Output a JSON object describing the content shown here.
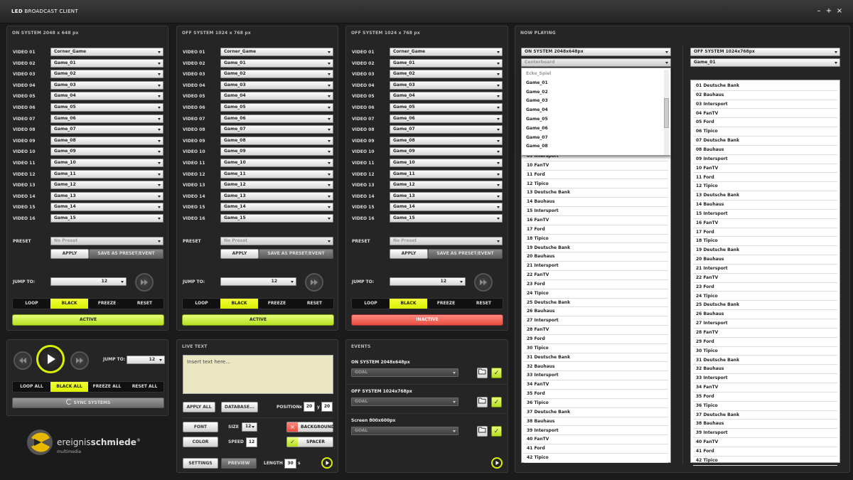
{
  "app": {
    "title_bold": "LED",
    "title_rest": " BROADCAST CLIENT",
    "win_min": "–",
    "win_max": "+",
    "win_close": "×"
  },
  "video_label_prefix": "VIDEO",
  "panels": [
    {
      "title": "ON SYSTEM 2048 x 648 px",
      "videos": [
        {
          "label": "VIDEO 01",
          "value": "Corner_Game"
        },
        {
          "label": "VIDEO 02",
          "value": "Game_01"
        },
        {
          "label": "VIDEO 03",
          "value": "Game_02"
        },
        {
          "label": "VIDEO 04",
          "value": "Game_03"
        },
        {
          "label": "VIDEO 05",
          "value": "Game_04"
        },
        {
          "label": "VIDEO 06",
          "value": "Game_05"
        },
        {
          "label": "VIDEO 07",
          "value": "Game_06"
        },
        {
          "label": "VIDEO 08",
          "value": "Game_07"
        },
        {
          "label": "VIDEO 09",
          "value": "Game_08"
        },
        {
          "label": "VIDEO 10",
          "value": "Game_09"
        },
        {
          "label": "VIDEO 11",
          "value": "Game_10"
        },
        {
          "label": "VIDEO 12",
          "value": "Game_11"
        },
        {
          "label": "VIDEO 13",
          "value": "Game_12"
        },
        {
          "label": "VIDEO 14",
          "value": "Game_13"
        },
        {
          "label": "VIDEO 15",
          "value": "Game_14"
        },
        {
          "label": "VIDEO 16",
          "value": "Game_15"
        }
      ],
      "preset_label": "PRESET",
      "preset_value": "No Preset",
      "apply": "APPLY",
      "save": "SAVE AS PRESET/EVENT",
      "jump_label": "JUMP TO:",
      "jump_value": "12",
      "modes": [
        "LOOP",
        "BLACK",
        "FREEZE",
        "RESET"
      ],
      "mode_active": "BLACK",
      "status": "ACTIVE"
    },
    {
      "title": "OFF SYSTEM 1024 x 768 px",
      "videos": [
        {
          "label": "VIDEO 01",
          "value": "Corner_Game"
        },
        {
          "label": "VIDEO 02",
          "value": "Game_01"
        },
        {
          "label": "VIDEO 03",
          "value": "Game_02"
        },
        {
          "label": "VIDEO 04",
          "value": "Game_03"
        },
        {
          "label": "VIDEO 05",
          "value": "Game_04"
        },
        {
          "label": "VIDEO 06",
          "value": "Game_05"
        },
        {
          "label": "VIDEO 07",
          "value": "Game_06"
        },
        {
          "label": "VIDEO 08",
          "value": "Game_07"
        },
        {
          "label": "VIDEO 09",
          "value": "Game_08"
        },
        {
          "label": "VIDEO 10",
          "value": "Game_09"
        },
        {
          "label": "VIDEO 11",
          "value": "Game_10"
        },
        {
          "label": "VIDEO 12",
          "value": "Game_11"
        },
        {
          "label": "VIDEO 13",
          "value": "Game_12"
        },
        {
          "label": "VIDEO 14",
          "value": "Game_13"
        },
        {
          "label": "VIDEO 15",
          "value": "Game_14"
        },
        {
          "label": "VIDEO 16",
          "value": "Game_15"
        }
      ],
      "preset_label": "PRESET",
      "preset_value": "No Preset",
      "apply": "APPLY",
      "save": "SAVE AS PRESET/EVENT",
      "jump_label": "JUMP TO:",
      "jump_value": "12",
      "modes": [
        "LOOP",
        "BLACK",
        "FREEZE",
        "RESET"
      ],
      "mode_active": "BLACK",
      "status": "ACTIVE"
    },
    {
      "title": "OFF SYSTEM 1024 x 768 px",
      "videos": [
        {
          "label": "VIDEO 01",
          "value": "Corner_Game"
        },
        {
          "label": "VIDEO 02",
          "value": "Game_01"
        },
        {
          "label": "VIDEO 03",
          "value": "Game_02"
        },
        {
          "label": "VIDEO 04",
          "value": "Game_03"
        },
        {
          "label": "VIDEO 05",
          "value": "Game_04"
        },
        {
          "label": "VIDEO 06",
          "value": "Game_05"
        },
        {
          "label": "VIDEO 07",
          "value": "Game_06"
        },
        {
          "label": "VIDEO 08",
          "value": "Game_07"
        },
        {
          "label": "VIDEO 09",
          "value": "Game_08"
        },
        {
          "label": "VIDEO 10",
          "value": "Game_09"
        },
        {
          "label": "VIDEO 11",
          "value": "Game_10"
        },
        {
          "label": "VIDEO 12",
          "value": "Game_11"
        },
        {
          "label": "VIDEO 13",
          "value": "Game_12"
        },
        {
          "label": "VIDEO 14",
          "value": "Game_13"
        },
        {
          "label": "VIDEO 15",
          "value": "Game_14"
        },
        {
          "label": "VIDEO 16",
          "value": "Game_15"
        }
      ],
      "preset_label": "PRESET",
      "preset_value": "No Preset",
      "apply": "APPLY",
      "save": "SAVE AS PRESET/EVENT",
      "jump_label": "JUMP TO:",
      "jump_value": "12",
      "modes": [
        "LOOP",
        "BLACK",
        "FREEZE",
        "RESET"
      ],
      "mode_active": "BLACK",
      "status": "INACTIVE"
    }
  ],
  "transport": {
    "jump_label": "JUMP TO:",
    "jump_value": "12",
    "modes": [
      "LOOP ALL",
      "BLACK ALL",
      "FREEZE ALL",
      "RESET ALL"
    ],
    "mode_active": "BLACK ALL",
    "sync": "SYNC SYSTEMS"
  },
  "logo": {
    "text_light": "ereignis",
    "text_bold": "schmiede",
    "reg": "®",
    "sub": "multimedia"
  },
  "live_text": {
    "title": "LIVE TEXT",
    "placeholder": "Insert text here...",
    "apply_all": "APPLY ALL",
    "database": "DATABASE...",
    "position_label": "POSITION",
    "x_label": "x",
    "x": "20",
    "y_label": "y",
    "y": "20",
    "font": "FONT",
    "size_label": "SIZE",
    "size": "12",
    "color": "COLOR",
    "speed_label": "SPEED",
    "speed": "12",
    "background": "BACKGROUND",
    "spacer": "SPACER",
    "settings": "SETTINGS",
    "preview": "PREVIEW",
    "length_label": "LENGTH",
    "length": "30",
    "length_unit": "s"
  },
  "events": {
    "title": "EVENTS",
    "items": [
      {
        "title": "ON SYSTEM 2048x648px",
        "value": "GOAL"
      },
      {
        "title": "OFF SYSTEM 1024x768px",
        "value": "GOAL"
      },
      {
        "title": "Screen 800x600px",
        "value": "GOAL"
      }
    ]
  },
  "now_playing": {
    "title": "NOW PLAYING",
    "left": {
      "system": "ON SYSTEM 2048x648px",
      "video": "Centerboard",
      "dropdown_options": [
        "Ecke_Spiel",
        "Game_01",
        "Game_02",
        "Game_03",
        "Game_04",
        "Game_05",
        "Game_06",
        "Game_07",
        "Game_08"
      ],
      "items": [
        "09 Intersport",
        "10 FanTV",
        "11 Ford",
        "12 Tipico",
        "13 Deutsche Bank",
        "14 Bauhaus",
        "15 Intersport",
        "16 FanTV",
        "17 Ford",
        "18 Tipico",
        "19 Deutsche Bank",
        "20 Bauhaus",
        "21 Intersport",
        "22 FanTV",
        "23 Ford",
        "24 Tipico",
        "25 Deutsche Bank",
        "26 Bauhaus",
        "27 Intersport",
        "28 FanTV",
        "29 Ford",
        "30 Tipico",
        "31 Deutsche Bank",
        "32 Bauhaus",
        "33 Intersport",
        "34 FanTV",
        "35 Ford",
        "36 Tipico",
        "37 Deutsche Bank",
        "38 Bauhaus",
        "39 Intersport",
        "40 FanTV",
        "41 Ford",
        "42 Tipico"
      ]
    },
    "right": {
      "system": "OFF SYSTEM 1024x768px",
      "video": "Game_01",
      "items": [
        "01 Deutsche Bank",
        "02 Bauhaus",
        "03 Intersport",
        "04 FanTV",
        "05 Ford",
        "06 Tipico",
        "07 Deutsche Bank",
        "08 Bauhaus",
        "09 Intersport",
        "10 FanTV",
        "11 Ford",
        "12 Tipico",
        "13 Deutsche Bank",
        "14 Bauhaus",
        "15 Intersport",
        "16 FanTV",
        "17 Ford",
        "18 Tipico",
        "19 Deutsche Bank",
        "20 Bauhaus",
        "21 Intersport",
        "22 FanTV",
        "23 Ford",
        "24 Tipico",
        "25 Deutsche Bank",
        "26 Bauhaus",
        "27 Intersport",
        "28 FanTV",
        "29 Ford",
        "30 Tipico",
        "31 Deutsche Bank",
        "32 Bauhaus",
        "33 Intersport",
        "34 FanTV",
        "35 Ford",
        "36 Tipico",
        "37 Deutsche Bank",
        "38 Bauhaus",
        "39 Intersport",
        "40 FanTV",
        "41 Ford",
        "42 Tipico"
      ]
    }
  },
  "colors": {
    "accent": "#d9f000",
    "active": "#b3de1e",
    "inactive": "#e84c41",
    "bg": "#1b1b1b"
  }
}
